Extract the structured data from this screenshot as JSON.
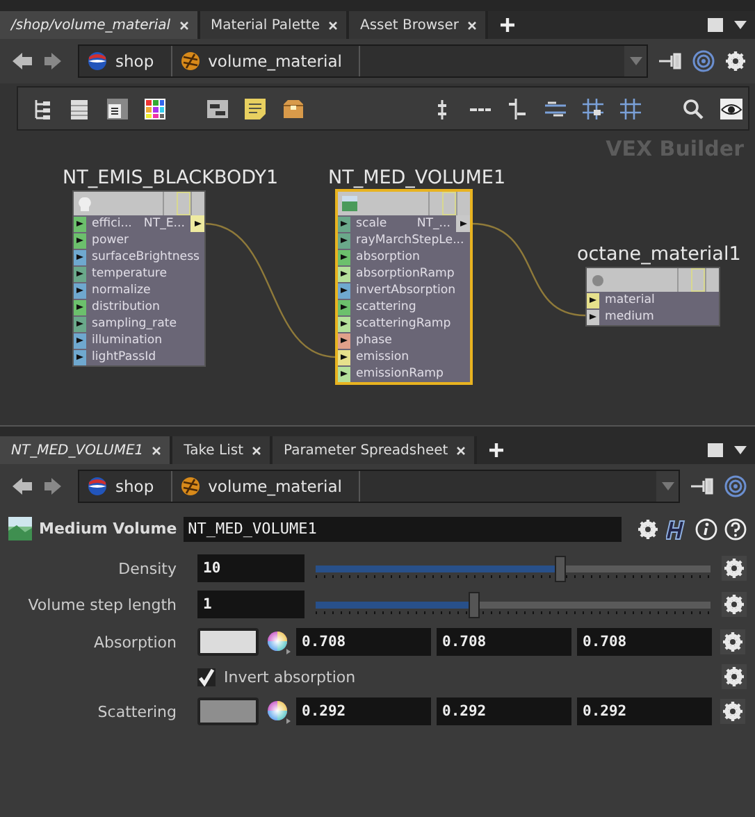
{
  "top_tabs": [
    {
      "label": "/shop/volume_material",
      "selected": true
    },
    {
      "label": "Material Palette",
      "selected": false
    },
    {
      "label": "Asset Browser",
      "selected": false
    }
  ],
  "top_path": {
    "segments": [
      "shop",
      "volume_material"
    ]
  },
  "network": {
    "context_label": "VEX Builder",
    "nodes": [
      {
        "name": "NT_EMIS_BLACKBODY1",
        "selected": false,
        "output_label": "NT_E...",
        "inputs": [
          {
            "label": "effici...",
            "color": "#6cc06c"
          },
          {
            "label": "power",
            "color": "#6cc06c"
          },
          {
            "label": "surfaceBrightness",
            "color": "#6fa8cf"
          },
          {
            "label": "temperature",
            "color": "#6aa88a"
          },
          {
            "label": "normalize",
            "color": "#6fa8cf"
          },
          {
            "label": "distribution",
            "color": "#6cc06c"
          },
          {
            "label": "sampling_rate",
            "color": "#6aa88a"
          },
          {
            "label": "illumination",
            "color": "#6fa8cf"
          },
          {
            "label": "lightPassId",
            "color": "#6fa8cf"
          }
        ]
      },
      {
        "name": "NT_MED_VOLUME1",
        "selected": true,
        "output_label": "NT_...",
        "inputs": [
          {
            "label": "scale",
            "color": "#6aa88a"
          },
          {
            "label": "rayMarchStepLe...",
            "color": "#6aa88a"
          },
          {
            "label": "absorption",
            "color": "#6cc06c"
          },
          {
            "label": "absorptionRamp",
            "color": "#b4e09a"
          },
          {
            "label": "invertAbsorption",
            "color": "#6fa8cf"
          },
          {
            "label": "scattering",
            "color": "#6cc06c"
          },
          {
            "label": "scatteringRamp",
            "color": "#b4e09a"
          },
          {
            "label": "phase",
            "color": "#e0a08a"
          },
          {
            "label": "emission",
            "color": "#e6e08c"
          },
          {
            "label": "emissionRamp",
            "color": "#b4e09a"
          }
        ]
      },
      {
        "name": "octane_material1",
        "selected": false,
        "inputs": [
          {
            "label": "material",
            "color": "#e6e08c"
          },
          {
            "label": "medium",
            "color": "#c8c8c8"
          }
        ]
      }
    ]
  },
  "bottom_tabs": [
    {
      "label": "NT_MED_VOLUME1",
      "selected": true
    },
    {
      "label": "Take List",
      "selected": false
    },
    {
      "label": "Parameter Spreadsheet",
      "selected": false
    }
  ],
  "bottom_path": {
    "segments": [
      "shop",
      "volume_material"
    ]
  },
  "parameters": {
    "type_label": "Medium Volume",
    "node_name": "NT_MED_VOLUME1",
    "rows": [
      {
        "kind": "slider",
        "label": "Density",
        "value": "10",
        "level": 0.62
      },
      {
        "kind": "slider",
        "label": "Volume step length",
        "value": "1",
        "level": 0.4
      },
      {
        "kind": "color",
        "label": "Absorption",
        "color": "#dcdcdc",
        "values": [
          "0.708",
          "0.708",
          "0.708"
        ]
      },
      {
        "kind": "checkbox",
        "label": "Invert absorption",
        "checked": true
      },
      {
        "kind": "color",
        "label": "Scattering",
        "color": "#8e8e8e",
        "values": [
          "0.292",
          "0.292",
          "0.292"
        ]
      }
    ]
  }
}
